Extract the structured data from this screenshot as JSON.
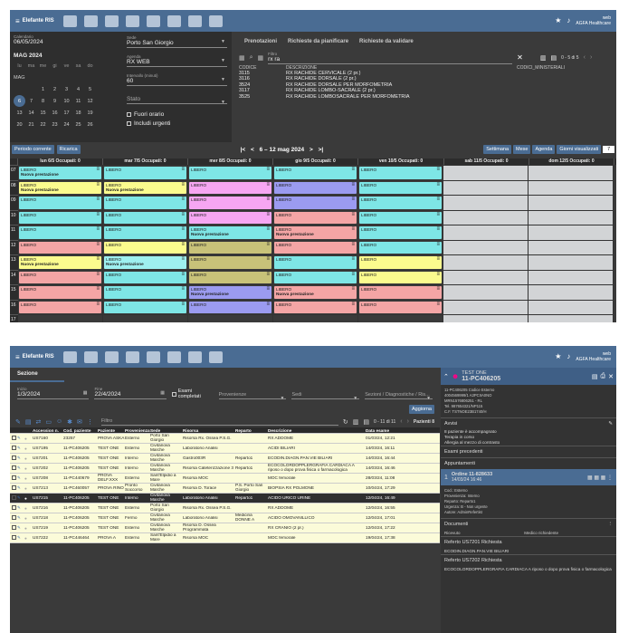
{
  "top": {
    "brand": "Elefante RIS",
    "user": "web",
    "org": "AGFA Healthcare"
  },
  "scheduler": {
    "calendar_label": "Calendario",
    "calendar_value": "06/05/2024",
    "month": "MAG 2024",
    "weekdays": [
      "lu",
      "ma",
      "me",
      "gi",
      "ve",
      "sa",
      "do"
    ],
    "mag": "MAG",
    "weeks": [
      [
        "",
        "",
        "1",
        "2",
        "3",
        "4",
        "5"
      ],
      [
        "6",
        "7",
        "8",
        "9",
        "10",
        "11",
        "12"
      ],
      [
        "13",
        "14",
        "15",
        "16",
        "17",
        "18",
        "19"
      ],
      [
        "20",
        "21",
        "22",
        "23",
        "24",
        "25",
        "26"
      ]
    ],
    "sede_label": "Sede",
    "sede": "Porto San Giorgio",
    "agenda_label": "Agenda",
    "agenda": "RX WEB",
    "intervallo_label": "Intervallo (minuti)",
    "intervallo": "60",
    "stato": "Stato",
    "fuori_orario": "Fuori orario",
    "urgenti": "Includi urgenti",
    "tabs": [
      "Prenotazioni",
      "Richieste da pianificare",
      "Richieste da validare"
    ],
    "filtro_label": "Filtro",
    "filtro": "rx ra",
    "pager": "0 - 5 di 5",
    "codes_header": {
      "codice": "CODICE",
      "descrizione": "DESCRIZIONE",
      "ministeriali": "CODICI_MINISTERIALI"
    },
    "codes": [
      {
        "c": "3115",
        "d": "RX RACHIDE CERVICALE (2 pr.)"
      },
      {
        "c": "3116",
        "d": "RX RACHIDE DORSALE (2 pr.)"
      },
      {
        "c": "3524",
        "d": "RX RACHIDE DORSALE PER MORFOMETRIA"
      },
      {
        "c": "3117",
        "d": "RX RACHIDE LOMBO-SACRALE (2 pr.)"
      },
      {
        "c": "3525",
        "d": "RX RACHIDE LOMBOSACRALE PER MORFOMETRIA"
      }
    ],
    "bar": {
      "periodo": "Periodo corrente",
      "ricarica": "Ricarica",
      "range": "6 – 12 mag 2024",
      "settimana": "Settimana",
      "mese": "Mese",
      "agenda": "Agenda",
      "giorni": "Giorni visualizzati",
      "giorni_val": "7"
    },
    "days": [
      "lun 6/5 Occupati: 0",
      "mar 7/5 Occupati: 0",
      "mer 8/5 Occupati: 0",
      "gio 9/5 Occupati: 0",
      "ven 10/5 Occupati: 0",
      "sab 11/5 Occupati: 0",
      "dom 12/5 Occupati: 0"
    ],
    "hours": [
      "07",
      "08",
      "09",
      "10",
      "11",
      "12",
      "13",
      "14",
      "15",
      "16",
      "17"
    ],
    "libero": "LIBERO",
    "nuova": "Nuova prestazione"
  },
  "worklist": {
    "sezione": "Sezione",
    "inizio_label": "Inizio",
    "inizio": "1/3/2024",
    "fine_label": "Fine",
    "fine": "22/4/2024",
    "esami": "Esami completati",
    "provenienze": "Provenienze",
    "sedi": "Sedi",
    "sezioni": "Sezioni / Diagnostiche / Ris...",
    "aggiorna": "Aggiorna",
    "filtro": "Filtro",
    "pager": "0 - 11 di 11",
    "pazienti": "Pazienti 8",
    "cols": [
      "Accession n.",
      "Cod. paziente",
      "Paziente",
      "Provenienza",
      "Sede",
      "Risorsa",
      "Reparto",
      "Descrizione",
      "Data esame"
    ],
    "rows": [
      [
        "US7160",
        "23257",
        "PROVA ASKA",
        "Esterno",
        "Porto San Giorgio",
        "Risorsa Rx. Ossea P.S.G.",
        "",
        "RX ADDOME",
        "01/03/24, 12:21"
      ],
      [
        "US7195",
        "11-PC406205",
        "TEST ONE",
        "Esterno",
        "Civitanova Marche",
        "Laboratorio Analisi",
        "",
        "ACIDI BILIARI",
        "14/03/24, 16:11"
      ],
      [
        "US7201",
        "11-PC406205",
        "TEST ONE",
        "Interno",
        "Civitanova Marche",
        "Gastro003R",
        "Reparto1",
        "ECODIN.DIAGN.PAN.VIE BILIARI",
        "14/03/24, 16:44"
      ],
      [
        "US7202",
        "11-PC406205",
        "TEST ONE",
        "Interno",
        "Civitanova Marche",
        "Risorsa Cateterizzazione 3",
        "Reparto1",
        "ECOCOLORDOPPLERGRAFIA CARDIACA A riposo o dopo prova fisica o farmacologica",
        "14/03/24, 16:46"
      ],
      [
        "US7208",
        "11-PC440679",
        "PROVA DELF.XXX",
        "Esterno",
        "Sant'Elpidio a Mare",
        "Risorsa MOC",
        "",
        "MOC femorale",
        "28/03/24, 11:08"
      ],
      [
        "US7213",
        "11-PC460057",
        "PROVA RINO",
        "Pronto Soccorso",
        "Civitanova Marche",
        "Risorsa D. Torace",
        "P.S. Porto San Giorgio",
        "BIOPSIA RX POLMONE",
        "10/04/24, 17:29"
      ],
      [
        "US7215",
        "11-PC406205",
        "TEST ONE",
        "Interno",
        "Civitanova Marche",
        "Laboratorio Analisi",
        "Reparto1",
        "ACIDO URICO URINE",
        "12/04/24, 16:49"
      ],
      [
        "US7216",
        "11-PC406205",
        "TEST ONE",
        "Esterno",
        "Porto San Giorgio",
        "Risorsa Rx. Ossea P.S.G.",
        "",
        "RX ADDOME",
        "12/04/24, 16:55"
      ],
      [
        "US7218",
        "11-PC406205",
        "TEST ONE",
        "Fermo",
        "Civitanova Marche",
        "Laboratorio Analisi",
        "Medicina DONNE A",
        "ACIDO OMOVANILLICO",
        "12/04/24, 17:01"
      ],
      [
        "US7219",
        "11-PC406205",
        "TEST ONE",
        "Esterno",
        "Civitanova Marche",
        "Risorsa D. Ossea Programmata",
        "",
        "RX CRANIO (2 pr.)",
        "12/04/24, 17:22"
      ],
      [
        "US7222",
        "11-PC446464",
        "PROVA A",
        "Esterno",
        "Sant'Elpidio a Mare",
        "Risorsa MOC",
        "",
        "MOC femorale",
        "19/04/24, 17:38"
      ]
    ],
    "panel": {
      "name": "TEST ONE",
      "id": "11-PC406205",
      "info": [
        "11-PC406205 Codice Esterno",
        "4004569999/1 A3PCIIA0NO",
        "MRN1576806251 - RL",
        "Tel. 987654321/NP115",
        "C.F. TSTNOE23B1740/H"
      ],
      "avvisi": "Avvisi",
      "avvisi_items": [
        "8 paziente è accompagnato",
        "Terapia in corso",
        "Allergia al mezzo di contrasto"
      ],
      "esami_prec": "Esami precedenti",
      "appuntamenti": "Appuntamenti",
      "ordine": "Ordine 11-828633",
      "ordine_date": "14/03/24 16:46",
      "ord_info": [
        "Cod.: Esterno",
        "Provenienza: Interno",
        "Reparto: Reparto1",
        "Urgenza: B - Non urgente",
        "Autore: AdminRefertist"
      ],
      "documenti": "Documenti",
      "doc_cols": [
        "Ricevuto",
        "Medico richiedente"
      ],
      "ref1": "Referto  US7201  Richiesta",
      "ref1_desc": "ECODIN.DIAGN.PAN.VIE BILIARI",
      "ref2": "Referto  US7202  Richiesta",
      "ref2_desc": "ECOCOLORDOPPLERGRAFIA CARDIACA A riposo o dopo prova fisica o farmacologica"
    }
  },
  "colors": {
    "cyan": "#7ee6e6",
    "yellow": "#fbfb8e",
    "pink": "#f4a5a5",
    "magenta": "#f6a6f2",
    "violet": "#9b9bf0",
    "olive": "#c8c279",
    "lightcyan": "#9ef0f0"
  }
}
